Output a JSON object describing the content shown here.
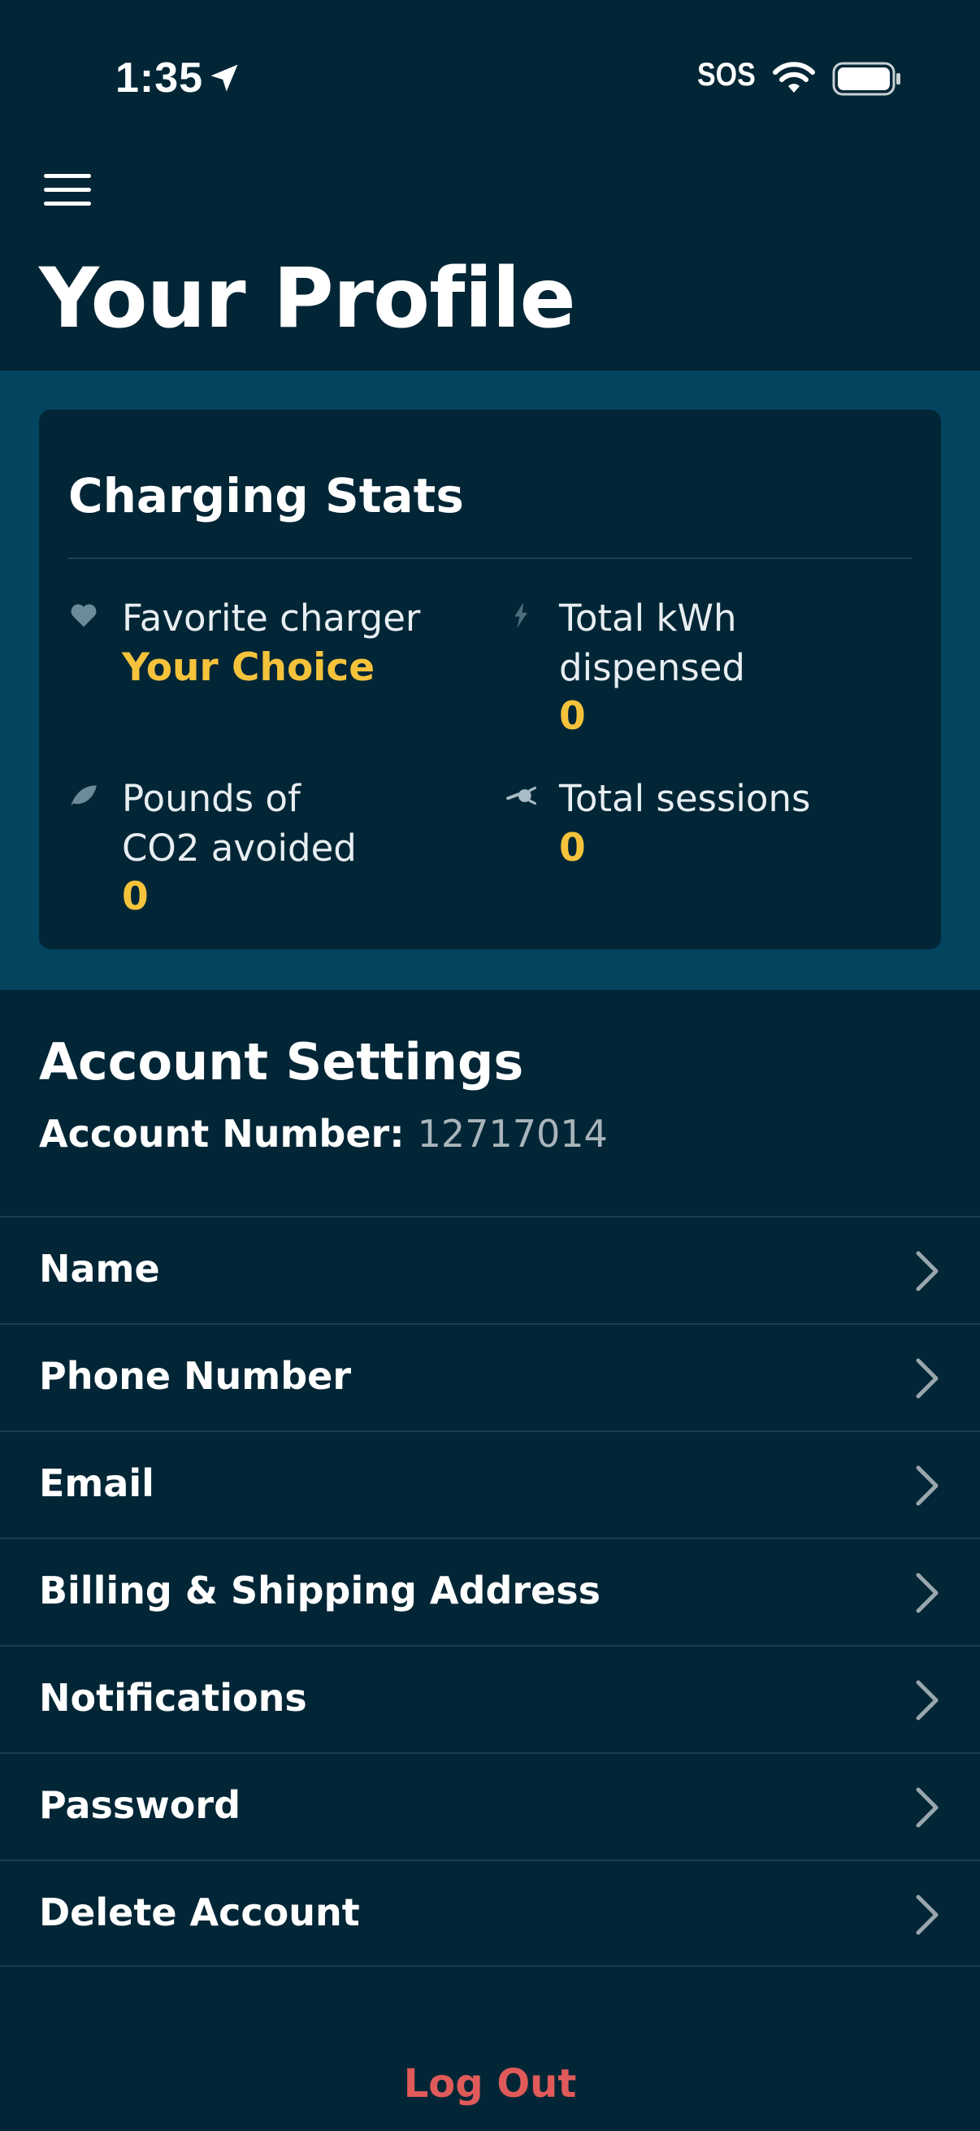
{
  "status_bar": {
    "time": "1:35",
    "sos": "SOS",
    "icons": [
      "location-arrow-icon",
      "wifi-icon",
      "battery-icon"
    ]
  },
  "header": {
    "title": "Your Profile",
    "menu_icon": "hamburger-menu-icon"
  },
  "charging_stats": {
    "title": "Charging Stats",
    "favorite_charger": {
      "label": "Favorite charger",
      "value": "Your Choice",
      "icon": "heart-icon"
    },
    "total_kwh": {
      "label": "Total kWh\ndispensed",
      "value": "0",
      "icon": "lightning-icon"
    },
    "co2_avoided": {
      "label": "Pounds of\nCO2 avoided",
      "value": "0",
      "icon": "leaf-icon"
    },
    "total_sessions": {
      "label": "Total sessions",
      "value": "0",
      "icon": "plug-icon"
    }
  },
  "account": {
    "title": "Account Settings",
    "number_label": "Account Number:",
    "number_value": "12717014",
    "items": [
      {
        "label": "Name"
      },
      {
        "label": "Phone Number"
      },
      {
        "label": "Email"
      },
      {
        "label": "Billing & Shipping Address"
      },
      {
        "label": "Notifications"
      },
      {
        "label": "Password"
      },
      {
        "label": "Delete Account"
      }
    ]
  },
  "logout_label": "Log Out",
  "colors": {
    "background": "#022636",
    "stats_band": "#03445f",
    "accent_yellow": "#f5c33b",
    "logout_red": "#e05a5a",
    "muted_text": "#a9b4bb"
  }
}
